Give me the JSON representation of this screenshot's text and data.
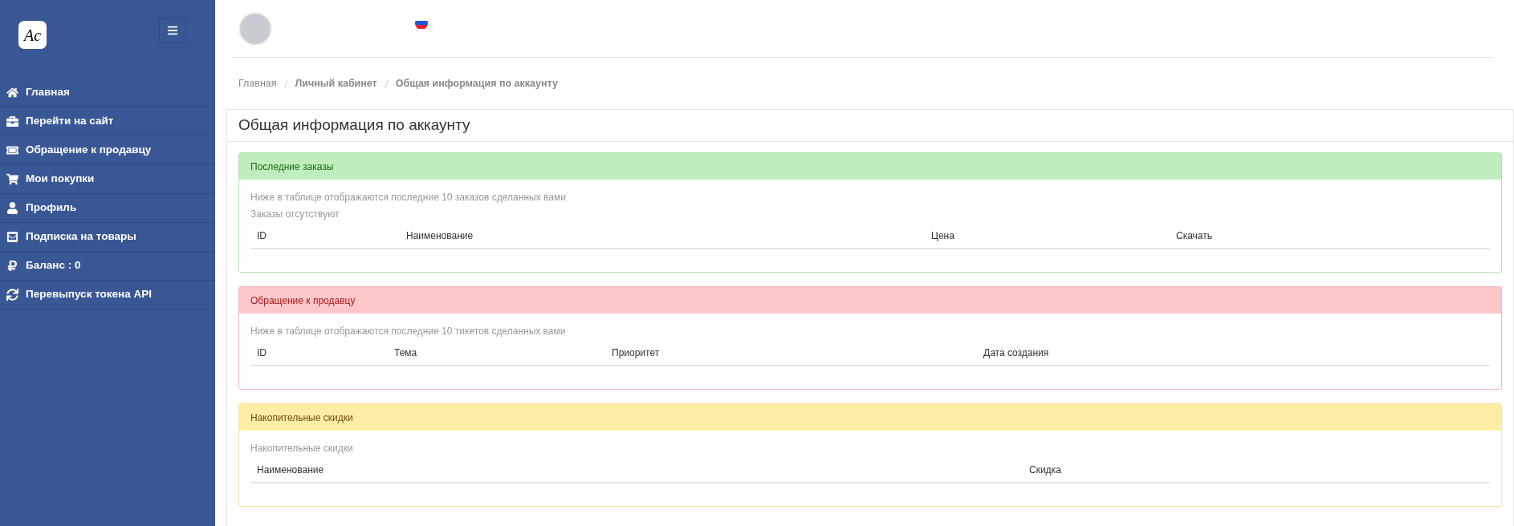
{
  "sidebar": {
    "logo": "Ac",
    "items": [
      {
        "label": "Главная"
      },
      {
        "label": "Перейти на сайт"
      },
      {
        "label": "Обращение к продавцу"
      },
      {
        "label": "Мои покупки"
      },
      {
        "label": "Профиль"
      },
      {
        "label": "Подписка на товары"
      },
      {
        "label": "Баланс : 0"
      },
      {
        "label": "Перевыпуск токена API"
      }
    ]
  },
  "breadcrumb": [
    "Главная",
    "Личный кабинет",
    "Общая информация по аккаунту"
  ],
  "page_title": "Общая информация по аккаунту",
  "panels": [
    {
      "kind": "success",
      "title": "Последние заказы",
      "notes": [
        "Ниже в таблице отображаются последние 10 заказов сделанных вами",
        "Заказы отсутствуют"
      ],
      "columns": [
        "ID",
        "Наименование",
        "Цена",
        "Скачать"
      ]
    },
    {
      "kind": "danger",
      "title": "Обращение к продавцу",
      "notes": [
        "Ниже в таблице отображаются последние 10 тикетов сделанных вами"
      ],
      "columns": [
        "ID",
        "Тема",
        "Приоритет",
        "Дата создания"
      ]
    },
    {
      "kind": "warning",
      "title": "Накопительные скидки",
      "notes": [
        "Накопительные скидки"
      ],
      "columns": [
        "Наименование",
        "Скидка"
      ]
    }
  ]
}
